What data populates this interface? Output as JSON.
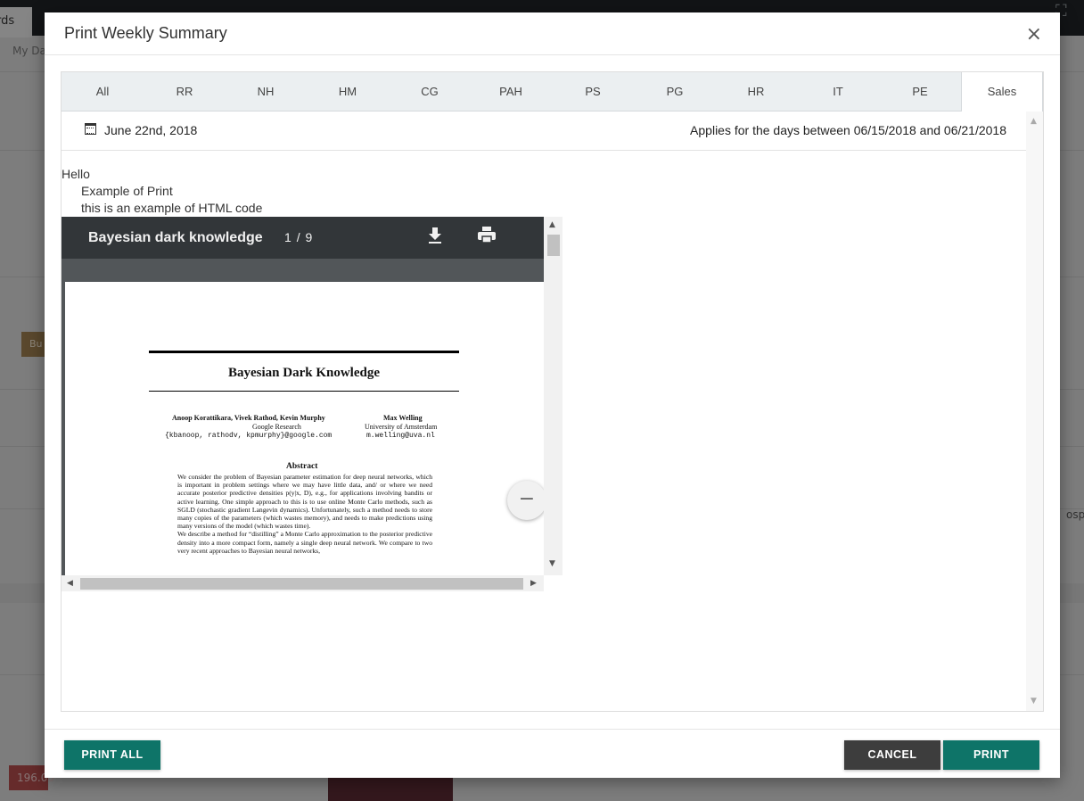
{
  "background": {
    "tab_label": "rds",
    "sub_label": "My Da",
    "badge": "Bu",
    "value_badge": "196.00",
    "side_text": "ospi"
  },
  "modal": {
    "title": "Print Weekly Summary",
    "close_label": "×"
  },
  "tabs": [
    {
      "label": "All"
    },
    {
      "label": "RR"
    },
    {
      "label": "NH"
    },
    {
      "label": "HM"
    },
    {
      "label": "CG"
    },
    {
      "label": "PAH"
    },
    {
      "label": "PS"
    },
    {
      "label": "PG"
    },
    {
      "label": "HR"
    },
    {
      "label": "IT"
    },
    {
      "label": "PE"
    },
    {
      "label": "Sales"
    }
  ],
  "active_tab": "Sales",
  "summary": {
    "date": "June 22nd, 2018",
    "applies": "Applies for the days between 06/15/2018 and 06/21/2018",
    "line1": "Hello",
    "line2": "Example of Print",
    "line3": "this is an example of HTML code"
  },
  "pdf": {
    "title": "Bayesian dark knowledge",
    "page_current": "1",
    "page_sep": "/",
    "page_total": "9",
    "paper_title": "Bayesian Dark Knowledge",
    "authors1": "Anoop Korattikara, Vivek Rathod, Kevin Murphy",
    "affil1": "Google Research",
    "email1": "{kbanoop, rathodv, kpmurphy}@google.com",
    "authors2": "Max Welling",
    "affil2": "University of Amsterdam",
    "email2": "m.welling@uva.nl",
    "abstract_heading": "Abstract",
    "abstract_p1": "We consider the problem of Bayesian parameter estimation for deep neural networks, which is important in problem settings where we may have little data, and/ or where we need accurate posterior predictive densities p(y|x, D), e.g., for applications involving bandits or active learning. One simple approach to this is to use online Monte Carlo methods, such as SGLD (stochastic gradient Langevin dynamics). Unfortunately, such a method needs to store many copies of the parameters (which wastes memory), and needs to make predictions using many versions of the model (which wastes time).",
    "abstract_p2": "We describe a method for “distilling” a Monte Carlo approximation to the posterior predictive density into a more compact form, namely a single deep neural network. We compare to two very recent approaches to Bayesian neural networks,",
    "zoom_out": "−"
  },
  "footer": {
    "print_all": "PRINT ALL",
    "cancel": "CANCEL",
    "print": "PRINT"
  },
  "colors": {
    "primary": "#0e7468",
    "cancel": "#3d3d3d",
    "pdf_toolbar": "#323639"
  }
}
